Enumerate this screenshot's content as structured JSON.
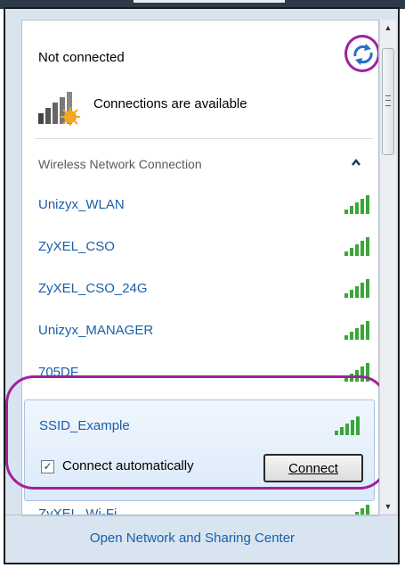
{
  "header": {
    "status": "Not connected",
    "availability": "Connections are available",
    "refresh_icon": "refresh-icon",
    "network_icon": "network-available-icon"
  },
  "section": {
    "label": "Wireless Network Connection",
    "collapse_icon": "chevron-up-icon"
  },
  "networks": [
    {
      "name": "Unizyx_WLAN",
      "signal_bars": 5
    },
    {
      "name": "ZyXEL_CSO",
      "signal_bars": 5
    },
    {
      "name": "ZyXEL_CSO_24G",
      "signal_bars": 5
    },
    {
      "name": "Unizyx_MANAGER",
      "signal_bars": 5
    },
    {
      "name": "705DF",
      "signal_bars": 5
    }
  ],
  "selected_network": {
    "name": "SSID_Example",
    "signal_bars": 5,
    "auto_connect_label": "Connect automatically",
    "auto_connect_checked": true,
    "connect_button_label": "Connect"
  },
  "partial_network": {
    "name": "ZyXEL_Wi-Fi"
  },
  "footer": {
    "link": "Open Network and Sharing Center"
  },
  "colors": {
    "link": "#1a5fa8",
    "highlight_ring": "#a020a0",
    "signal": "#3aa63a"
  }
}
